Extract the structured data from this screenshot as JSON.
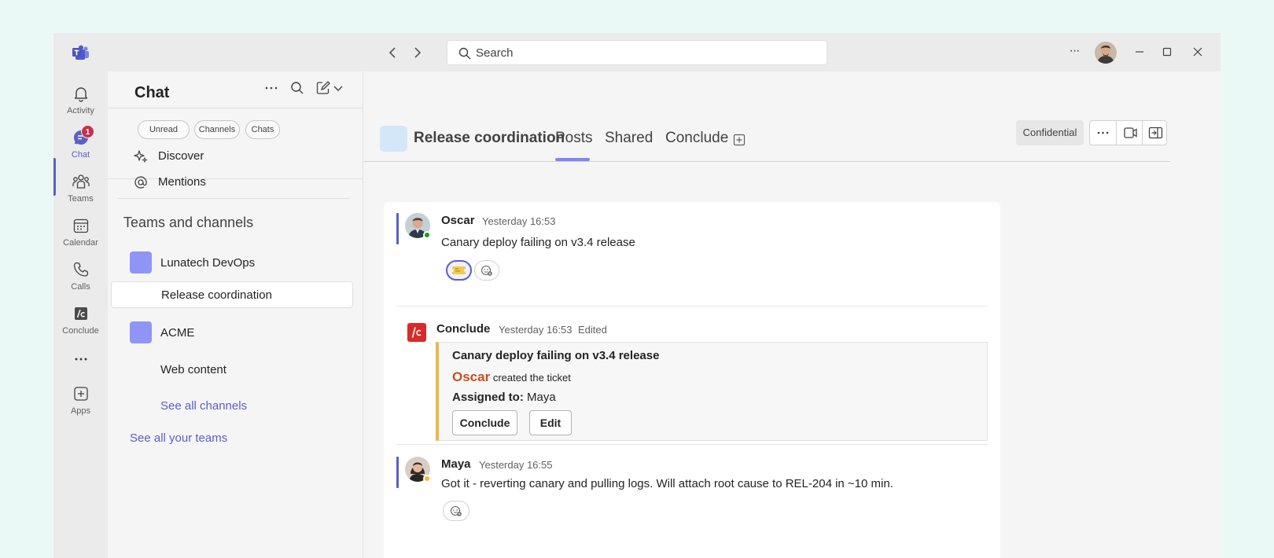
{
  "titlebar": {
    "search_placeholder": "Search",
    "more_label": "···"
  },
  "rail": {
    "items": [
      {
        "label": "Activity",
        "icon": "bell-icon"
      },
      {
        "label": "Chat",
        "icon": "chat-icon",
        "badge": "1"
      },
      {
        "label": "Teams",
        "icon": "teams-icon"
      },
      {
        "label": "Calendar",
        "icon": "calendar-icon"
      },
      {
        "label": "Calls",
        "icon": "phone-icon"
      },
      {
        "label": "Conclude",
        "icon": "conclude-icon"
      },
      {
        "label": "",
        "icon": "more-icon"
      },
      {
        "label": "Apps",
        "icon": "apps-icon"
      }
    ]
  },
  "panel": {
    "title": "Chat",
    "filters": [
      "Unread",
      "Channels",
      "Chats"
    ],
    "discover": "Discover",
    "mentions": "Mentions",
    "section_title": "Teams and channels",
    "teams": [
      {
        "name": "Lunatech DevOps",
        "channels": [
          "Release coordination"
        ]
      },
      {
        "name": "ACME",
        "channels": [
          "Web content"
        ]
      }
    ],
    "see_all_channels": "See all channels",
    "see_all_teams": "See all your teams"
  },
  "channel": {
    "title": "Release coordination",
    "tabs": [
      "Posts",
      "Shared",
      "Conclude"
    ],
    "active_tab": "Posts",
    "label": "Confidential"
  },
  "messages": {
    "root": {
      "author": "Oscar",
      "time": "Yesterday 16:53",
      "text": "Canary deploy failing on v3.4 release",
      "reaction": "ticket-emoji"
    },
    "bot_reply": {
      "author": "Conclude",
      "time": "Yesterday 16:53",
      "edited": "Edited",
      "card": {
        "title": "Canary deploy failing on v3.4 release",
        "creator": "Oscar",
        "created_text": "created the ticket",
        "assigned_label": "Assigned to:",
        "assigned_value": "Maya",
        "buttons": [
          "Conclude",
          "Edit"
        ]
      }
    },
    "reply": {
      "author": "Maya",
      "time": "Yesterday 16:55",
      "text": "Got it - reverting canary and pulling logs. Will attach root cause to REL-204 in ~10 min."
    }
  },
  "colors": {
    "accent": "#5b5fc7",
    "tab_underline": "#7f85f5",
    "card_accent": "#e8b84b",
    "creator_name": "#c4501f",
    "badge": "#c4314b",
    "presence_online": "#13a10e",
    "presence_away": "#f8b826"
  }
}
